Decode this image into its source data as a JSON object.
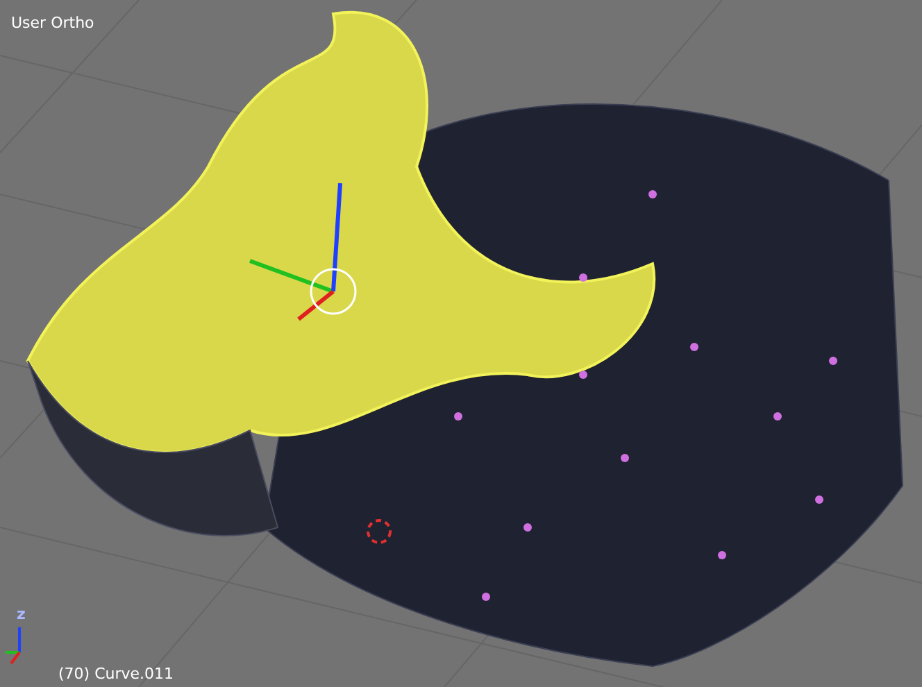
{
  "viewport": {
    "view_label": "User Ortho",
    "object_label": "(70) Curve.011",
    "axis_gizmo": {
      "z_label": "z"
    }
  }
}
